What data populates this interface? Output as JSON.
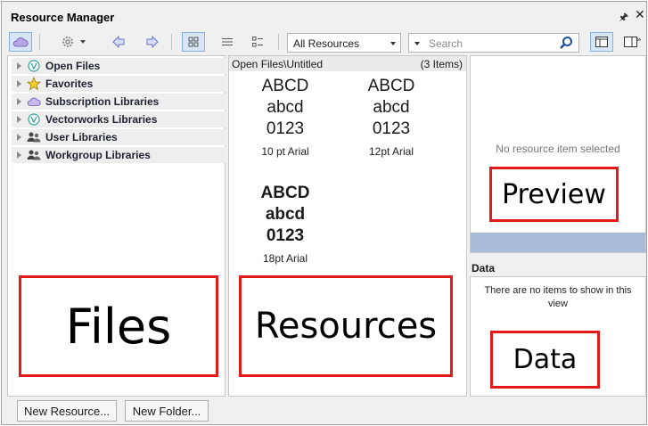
{
  "window": {
    "title": "Resource Manager",
    "pin_icon": "pin-icon",
    "close_icon": "close-icon"
  },
  "toolbar": {
    "resources_filter": "All Resources",
    "search_placeholder": "Search",
    "view_mode": "thumbnails",
    "icons": [
      "cloud-icon",
      "gear-icon",
      "chevron-down-icon",
      "back-arrow-icon",
      "forward-arrow-icon",
      "thumbnail-view-icon",
      "list-view-icon",
      "detail-view-icon",
      "search-icon",
      "single-pane-icon",
      "split-pane-icon"
    ]
  },
  "files": {
    "items": [
      {
        "label": "Open Files",
        "icon": "vectorworks-icon"
      },
      {
        "label": "Favorites",
        "icon": "star-icon"
      },
      {
        "label": "Subscription Libraries",
        "icon": "cloud-icon"
      },
      {
        "label": "Vectorworks Libraries",
        "icon": "vectorworks-icon"
      },
      {
        "label": "User Libraries",
        "icon": "users-icon"
      },
      {
        "label": "Workgroup Libraries",
        "icon": "users-icon"
      }
    ]
  },
  "resources": {
    "path": "Open Files\\Untitled",
    "count": "(3 Items)",
    "items": [
      {
        "lines": [
          "ABCD",
          "abcd",
          "0123"
        ],
        "caption": "10 pt Arial"
      },
      {
        "lines": [
          "ABCD",
          "abcd",
          "0123"
        ],
        "caption": "12pt Arial"
      },
      {
        "lines": [
          "ABCD",
          "abcd",
          "0123"
        ],
        "caption": "18pt Arial"
      }
    ]
  },
  "preview": {
    "empty_text": "No resource item selected"
  },
  "data_panel": {
    "title": "Data",
    "empty_text": "There are no items to show in this view"
  },
  "annotations": {
    "files": "Files",
    "resources": "Resources",
    "preview": "Preview",
    "data": "Data"
  },
  "buttons": {
    "new_resource": "New Resource...",
    "new_folder": "New Folder..."
  },
  "colors": {
    "annotation_border": "#e11a1a",
    "selection_blue": "#d8e6f7",
    "preview_bar": "#a8bcd8"
  }
}
